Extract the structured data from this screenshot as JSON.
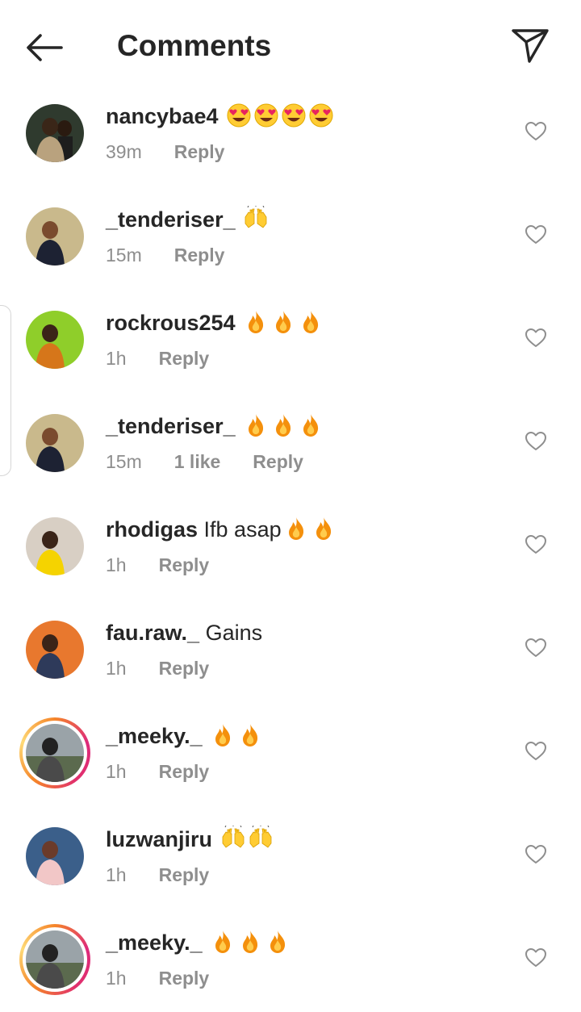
{
  "header": {
    "title": "Comments"
  },
  "comments": [
    {
      "username": "nancybae4",
      "text": "",
      "emoji": [
        "heart-eyes",
        "heart-eyes",
        "heart-eyes",
        "heart-eyes"
      ],
      "time": "39m",
      "likes": "",
      "reply": "Reply",
      "avatar": "couple",
      "story": false
    },
    {
      "username": "_tenderiser_",
      "text": "",
      "emoji": [
        "raised-hands"
      ],
      "time": "15m",
      "likes": "",
      "reply": "Reply",
      "avatar": "man-suit",
      "story": false
    },
    {
      "username": "rockrous254",
      "text": "",
      "emoji": [
        "fire",
        "fire",
        "fire"
      ],
      "time": "1h",
      "likes": "",
      "reply": "Reply",
      "avatar": "green",
      "story": false
    },
    {
      "username": "_tenderiser_",
      "text": "",
      "emoji": [
        "fire",
        "fire",
        "fire"
      ],
      "time": "15m",
      "likes": "1 like",
      "reply": "Reply",
      "avatar": "man-suit",
      "story": false
    },
    {
      "username": "rhodigas",
      "text": "Ifb asap",
      "emoji": [
        "fire",
        "fire"
      ],
      "time": "1h",
      "likes": "",
      "reply": "Reply",
      "avatar": "yellow",
      "story": false
    },
    {
      "username": "fau.raw._",
      "text": "Gains",
      "emoji": [],
      "time": "1h",
      "likes": "",
      "reply": "Reply",
      "avatar": "orange",
      "story": false
    },
    {
      "username": "_meeky._",
      "text": "",
      "emoji": [
        "fire",
        "fire"
      ],
      "time": "1h",
      "likes": "",
      "reply": "Reply",
      "avatar": "grey",
      "story": true
    },
    {
      "username": "luzwanjiru",
      "text": "",
      "emoji": [
        "raised-hands",
        "raised-hands"
      ],
      "time": "1h",
      "likes": "",
      "reply": "Reply",
      "avatar": "pink",
      "story": false
    },
    {
      "username": "_meeky._",
      "text": "",
      "emoji": [
        "fire",
        "fire",
        "fire"
      ],
      "time": "1h",
      "likes": "",
      "reply": "Reply",
      "avatar": "grey",
      "story": true
    }
  ],
  "colors": {
    "text": "#262626",
    "secondary": "#8e8e8e",
    "story_ring": "#dd2a7b"
  },
  "icons": {
    "back": "arrow-left-icon",
    "send": "paper-plane-icon",
    "like": "heart-outline-icon"
  }
}
